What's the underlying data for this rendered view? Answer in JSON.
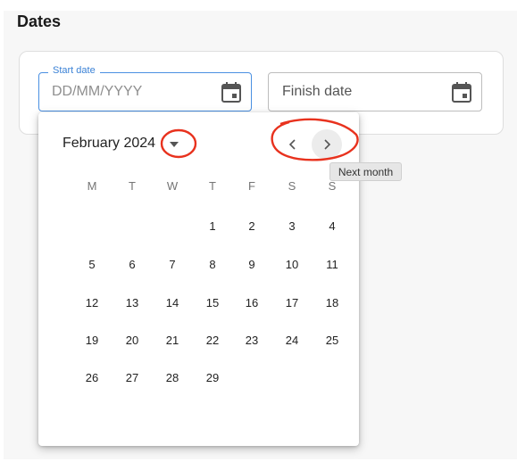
{
  "section": {
    "title": "Dates"
  },
  "start_date": {
    "legend": "Start date",
    "placeholder": "DD/MM/YYYY",
    "icon": "calendar-icon"
  },
  "finish_date": {
    "placeholder": "Finish date",
    "icon": "calendar-icon"
  },
  "calendar": {
    "month_label": "February 2024",
    "weekdays": [
      "M",
      "T",
      "W",
      "T",
      "F",
      "S",
      "S"
    ],
    "weeks": [
      [
        "",
        "",
        "",
        "1",
        "2",
        "3",
        "4"
      ],
      [
        "5",
        "6",
        "7",
        "8",
        "9",
        "10",
        "11"
      ],
      [
        "12",
        "13",
        "14",
        "15",
        "16",
        "17",
        "18"
      ],
      [
        "19",
        "20",
        "21",
        "22",
        "23",
        "24",
        "25"
      ],
      [
        "26",
        "27",
        "28",
        "29",
        "",
        "",
        ""
      ]
    ],
    "prev_icon": "chevron-left-icon",
    "next_icon": "chevron-right-icon"
  },
  "tooltip": {
    "text": "Next month"
  },
  "colors": {
    "accent": "#3b82d6",
    "annotation": "#e8321e"
  }
}
